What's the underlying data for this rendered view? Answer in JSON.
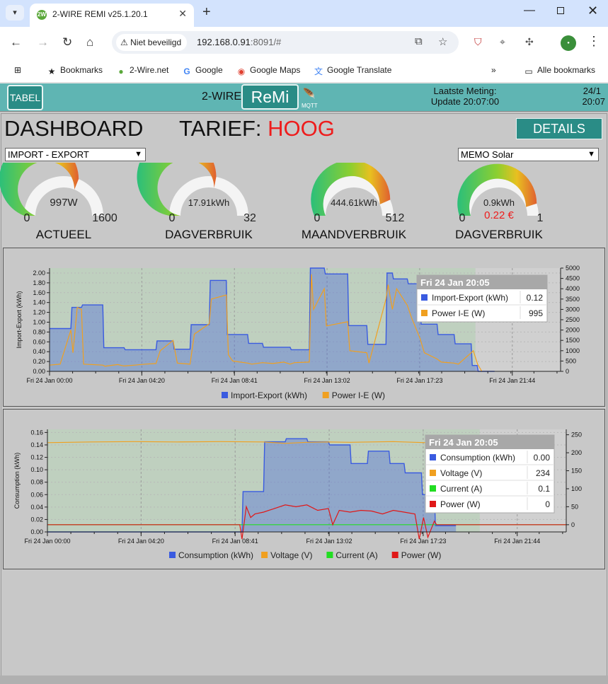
{
  "browser": {
    "tab_title": "2-WIRE REMI v25.1.20.1",
    "security_label": "Niet beveiligd",
    "url_host": "192.168.0.91",
    "url_port": ":8091/#",
    "bookmarks": [
      {
        "label": "Bookmarks",
        "icon": "star-icon"
      },
      {
        "label": "2-Wire.net",
        "icon": "twowire-favicon"
      },
      {
        "label": "Google",
        "icon": "google-icon"
      },
      {
        "label": "Google Maps",
        "icon": "maps-icon"
      },
      {
        "label": "Google Translate",
        "icon": "translate-icon"
      }
    ],
    "all_bookmarks": "Alle bookmarks"
  },
  "header": {
    "tabel": "TABEL",
    "brand": "2-WIRE",
    "remi": "ReMi",
    "mqtt": "MQTT",
    "meting_label": "Laatste Meting:",
    "meting_update": "Update 20:07:00",
    "date": "24/1",
    "time": "20:07"
  },
  "dashboard": {
    "title": "DASHBOARD",
    "tarief_label": "TARIEF:",
    "tarief_value": "HOOG",
    "details": "DETAILS",
    "select_left": "IMPORT - EXPORT",
    "select_right": "MEMO Solar"
  },
  "gauges": [
    {
      "value": "997W",
      "min": "0",
      "max": "1600",
      "label": "ACTUEEL",
      "fraction": 0.623,
      "extra": ""
    },
    {
      "value": "17.91kWh",
      "min": "0",
      "max": "32",
      "label": "DAGVERBRUIK",
      "fraction": 0.56,
      "extra": ""
    },
    {
      "value": "444.61kWh",
      "min": "0",
      "max": "512",
      "label": "MAANDVERBRUIK",
      "fraction": 0.868,
      "extra": ""
    },
    {
      "value": "0.9kWh",
      "min": "0",
      "max": "1",
      "label": "DAGVERBRUIK",
      "fraction": 0.9,
      "extra": "0.22 €"
    }
  ],
  "chart_data": [
    {
      "type": "area",
      "ylabel": "Import-Export (kWh)",
      "x_ticks": [
        "Fri 24 Jan 00:00",
        "Fri 24 Jan 04:20",
        "Fri 24 Jan 08:41",
        "Fri 24 Jan 13:02",
        "Fri 24 Jan 17:23",
        "Fri 24 Jan 21:44"
      ],
      "y_ticks": [
        "0.00",
        "0.20",
        "0.40",
        "0.60",
        "0.80",
        "1.00",
        "1.20",
        "1.40",
        "1.60",
        "1.80",
        "2.00"
      ],
      "y2_ticks": [
        "0",
        "500",
        "1000",
        "1500",
        "2000",
        "2500",
        "3000",
        "3500",
        "4000",
        "4500",
        "5000"
      ],
      "ylim": [
        0,
        2.1
      ],
      "y2lim": [
        0,
        5000
      ],
      "xlim_hours": [
        0,
        24
      ],
      "series": [
        {
          "name": "Import-Export (kWh)",
          "color": "#3a5be0",
          "axis": "left",
          "x": [
            0,
            1.0,
            1.05,
            1.5,
            1.55,
            2.5,
            2.55,
            3.5,
            3.55,
            5.0,
            5.05,
            5.8,
            5.85,
            6.6,
            6.65,
            7.5,
            7.55,
            8.3,
            8.35,
            9.3,
            9.35,
            10.0,
            10.05,
            11.3,
            11.35,
            12.2,
            12.25,
            12.9,
            12.95,
            14.0,
            14.05,
            14.9,
            14.95,
            15.8,
            15.85,
            16.1,
            16.15,
            16.8,
            16.85,
            17.4,
            17.45,
            18.2,
            18.25,
            19.0,
            19.05,
            19.8,
            19.85,
            20.08,
            20.13,
            20.9
          ],
          "y": [
            0.87,
            0.87,
            1.3,
            1.3,
            1.35,
            1.35,
            0.48,
            0.48,
            0.44,
            0.44,
            0.62,
            0.62,
            0.45,
            0.45,
            0.95,
            0.95,
            1.85,
            1.85,
            0.75,
            0.75,
            0.57,
            0.57,
            0.49,
            0.49,
            0.44,
            0.44,
            2.1,
            2.1,
            1.98,
            1.98,
            0.93,
            0.93,
            0.55,
            0.55,
            2.0,
            2.0,
            1.88,
            1.88,
            1.78,
            1.78,
            0.96,
            0.96,
            0.75,
            0.75,
            0.56,
            0.56,
            0.12,
            0.12,
            0.0,
            0.0
          ]
        },
        {
          "name": "Power I-E (W)",
          "color": "#f0a020",
          "axis": "right",
          "x": [
            0,
            0.5,
            1.0,
            1.1,
            1.3,
            1.5,
            1.6,
            2.5,
            2.6,
            3.2,
            3.5,
            4.0,
            4.5,
            5.0,
            5.2,
            5.8,
            6.0,
            6.6,
            6.8,
            7.5,
            7.6,
            8.3,
            8.4,
            8.6,
            9.3,
            9.5,
            10.0,
            10.5,
            11.0,
            11.3,
            11.5,
            12.2,
            12.3,
            12.4,
            12.9,
            13.0,
            14.0,
            14.1,
            14.9,
            15.0,
            15.8,
            15.9,
            16.1,
            16.3,
            16.8,
            17.0,
            17.4,
            17.6,
            18.2,
            18.4,
            19.0,
            19.2,
            19.8,
            19.9,
            20.1,
            20.3
          ],
          "y": [
            300,
            350,
            2000,
            900,
            3100,
            3000,
            350,
            300,
            250,
            330,
            260,
            300,
            350,
            380,
            1000,
            1500,
            400,
            350,
            1800,
            2300,
            3500,
            3700,
            800,
            500,
            400,
            350,
            420,
            380,
            450,
            350,
            420,
            450,
            4700,
            3000,
            4000,
            2200,
            2400,
            1000,
            900,
            400,
            3500,
            4200,
            3000,
            4000,
            3200,
            2600,
            1600,
            900,
            600,
            450,
            400,
            350,
            900,
            1000,
            350,
            0
          ]
        }
      ],
      "legend": "bottom",
      "tooltip": {
        "title": "Fri 24 Jan 20:05",
        "rows": [
          {
            "name": "Import-Export (kWh)",
            "value": "0.12",
            "color": "#3a5be0"
          },
          {
            "name": "Power I-E (W)",
            "value": "995",
            "color": "#f0a020"
          }
        ]
      }
    },
    {
      "type": "area",
      "ylabel": "Consumption (kWh)",
      "x_ticks": [
        "Fri 24 Jan 00:00",
        "Fri 24 Jan 04:20",
        "Fri 24 Jan 08:41",
        "Fri 24 Jan 13:02",
        "Fri 24 Jan 17:23",
        "Fri 24 Jan 21:44"
      ],
      "y_ticks": [
        "0.00",
        "0.02",
        "0.04",
        "0.06",
        "0.08",
        "0.10",
        "0.12",
        "0.14",
        "0.16"
      ],
      "y2_ticks": [
        "0",
        "50",
        "100",
        "150",
        "200",
        "250"
      ],
      "ylim": [
        0,
        0.165
      ],
      "y2lim": [
        -20,
        265
      ],
      "xlim_hours": [
        0,
        24
      ],
      "series": [
        {
          "name": "Consumption (kWh)",
          "color": "#3a5be0",
          "axis": "left",
          "x": [
            0,
            9.0,
            9.05,
            10.0,
            10.05,
            11.0,
            11.05,
            12.0,
            12.05,
            13.0,
            13.05,
            14.0,
            14.05,
            14.8,
            14.85,
            15.8,
            15.85,
            16.5,
            16.55,
            17.3,
            17.35,
            17.9,
            17.95,
            18.9
          ],
          "y": [
            0,
            0,
            0.065,
            0.065,
            0.145,
            0.145,
            0.15,
            0.15,
            0.145,
            0.145,
            0.14,
            0.14,
            0.11,
            0.11,
            0.13,
            0.13,
            0.11,
            0.11,
            0.095,
            0.095,
            0.06,
            0.06,
            0.01,
            0.01
          ]
        },
        {
          "name": "Voltage (V)",
          "color": "#f0a020",
          "axis": "right",
          "x": [
            0,
            2,
            4,
            6,
            8,
            10,
            11,
            12,
            13,
            14,
            16,
            18,
            19,
            19.5
          ],
          "y": [
            228,
            230,
            231,
            230,
            231,
            230,
            226,
            229,
            230,
            229,
            231,
            227,
            229,
            232
          ]
        },
        {
          "name": "Current (A)",
          "color": "#22dd22",
          "axis": "right",
          "x": [
            0,
            9.0,
            17.9,
            24
          ],
          "y": [
            0,
            0,
            0,
            0
          ]
        },
        {
          "name": "Power (W)",
          "color": "#e01818",
          "axis": "right",
          "x": [
            0,
            8.9,
            9.0,
            9.2,
            9.4,
            9.6,
            10.0,
            10.5,
            11.0,
            11.5,
            12.0,
            12.5,
            13.0,
            13.2,
            13.5,
            14.0,
            14.5,
            15.0,
            15.5,
            16.0,
            16.5,
            17.0,
            17.2,
            17.4,
            17.6,
            17.9,
            18.0,
            24
          ],
          "y": [
            0,
            0,
            -40,
            50,
            20,
            30,
            35,
            45,
            55,
            50,
            55,
            40,
            45,
            0,
            40,
            35,
            40,
            38,
            30,
            40,
            35,
            30,
            -40,
            20,
            -35,
            10,
            0,
            0
          ]
        }
      ],
      "legend": "bottom",
      "tooltip": {
        "title": "Fri 24 Jan 20:05",
        "rows": [
          {
            "name": "Consumption (kWh)",
            "value": "0.00",
            "color": "#3a5be0"
          },
          {
            "name": "Voltage (V)",
            "value": "234",
            "color": "#f0a020"
          },
          {
            "name": "Current (A)",
            "value": "0.1",
            "color": "#22dd22"
          },
          {
            "name": "Power (W)",
            "value": "0",
            "color": "#e01818"
          }
        ]
      }
    }
  ]
}
